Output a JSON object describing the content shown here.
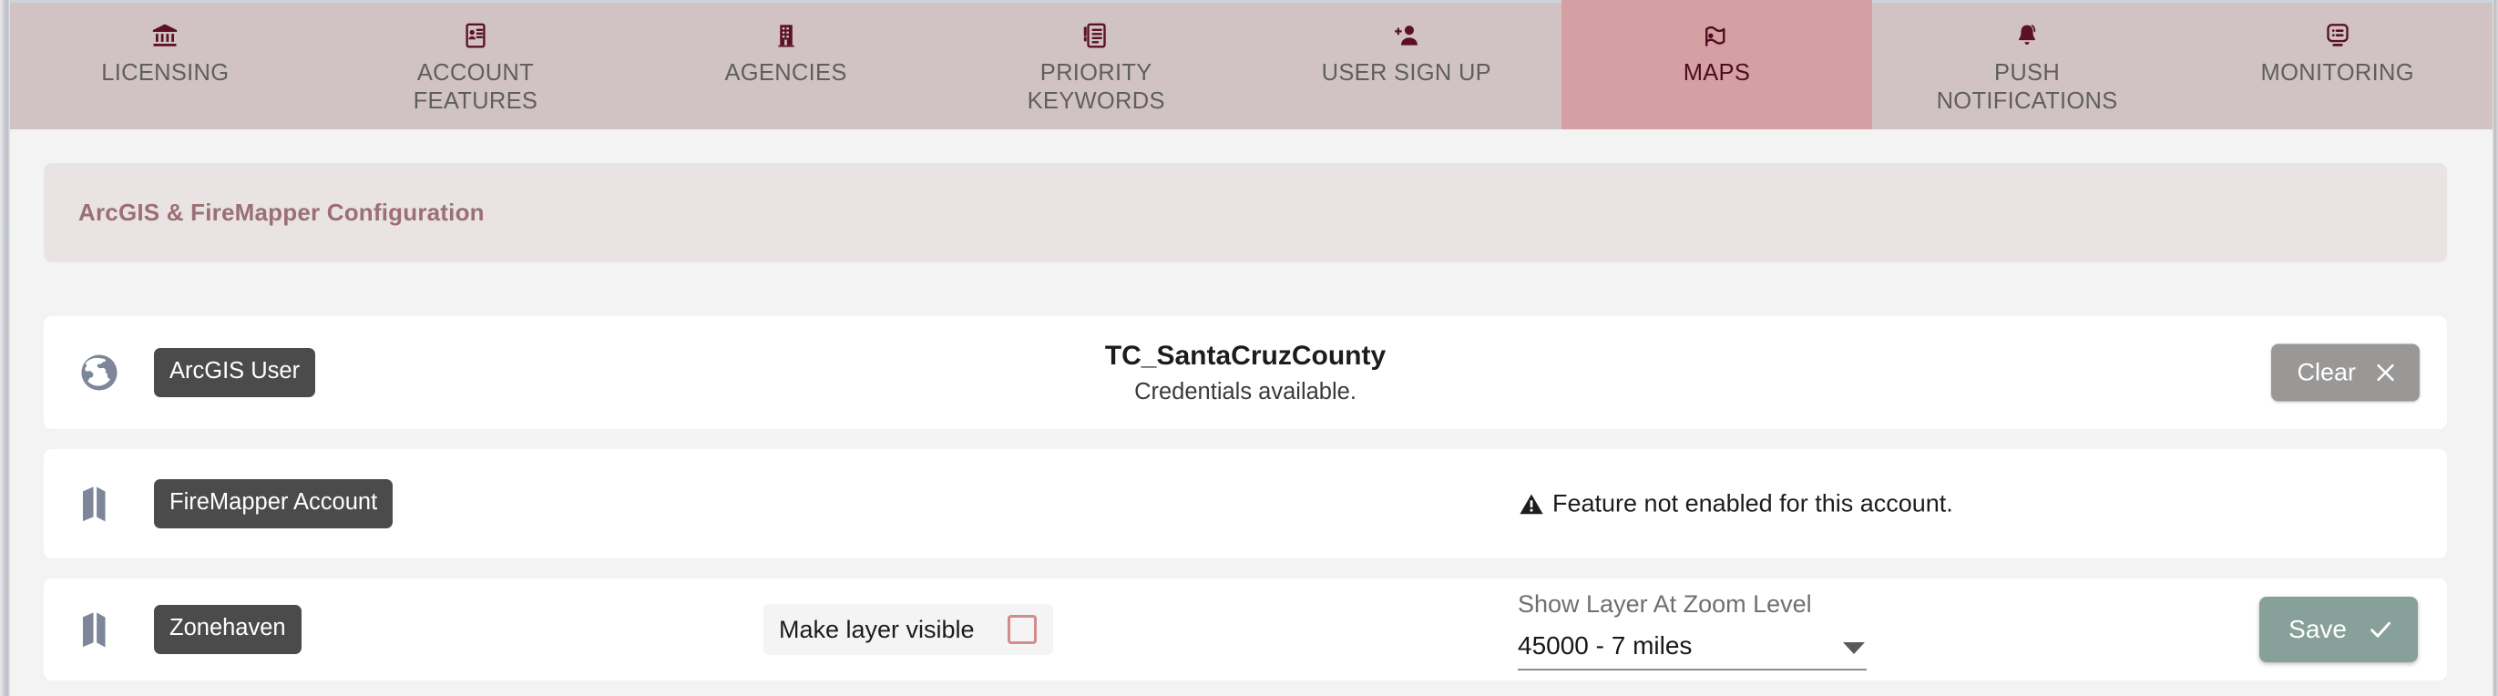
{
  "theme": {
    "tabbar_bg": "#d1c3c3",
    "tab_active_bg": "#d5a0a4",
    "accent_maroon": "#5c1026",
    "section_title_color": "#9b6f74",
    "chip_bg": "#4b4b4b",
    "map_icon_color": "#7e8699",
    "save_button_bg": "#87a099",
    "clear_button_bg": "#9a9797",
    "checkbox_border": "#d38b8b",
    "page_bg": "#f3f3f4"
  },
  "tabs": [
    {
      "label": "LICENSING",
      "icon": "bank-icon",
      "active": false
    },
    {
      "label": "ACCOUNT\nFEATURES",
      "icon": "account-features-icon",
      "active": false
    },
    {
      "label": "AGENCIES",
      "icon": "building-icon",
      "active": false
    },
    {
      "label": "PRIORITY\nKEYWORDS",
      "icon": "priority-keywords-icon",
      "active": false
    },
    {
      "label": "USER SIGN UP",
      "icon": "person-add-icon",
      "active": false
    },
    {
      "label": "MAPS",
      "icon": "map-flag-icon",
      "active": true
    },
    {
      "label": "PUSH\nNOTIFICATIONS",
      "icon": "bell-icon",
      "active": false
    },
    {
      "label": "MONITORING",
      "icon": "monitor-list-icon",
      "active": false
    }
  ],
  "section": {
    "title": "ArcGIS & FireMapper Configuration"
  },
  "rows": {
    "arcgis": {
      "icon": "globe-icon",
      "chip_label": "ArcGIS User",
      "account_name": "TC_SantaCruzCounty",
      "status_text": "Credentials available.",
      "clear_button_label": "Clear",
      "clear_button_icon": "close-icon"
    },
    "firemapper": {
      "icon": "map-icon",
      "chip_label": "FireMapper Account",
      "warning_icon": "warning-triangle-icon",
      "warning_text": "Feature not enabled for this account."
    },
    "zonehaven": {
      "icon": "map-icon",
      "chip_label": "Zonehaven",
      "checkbox_label": "Make layer visible",
      "checkbox_checked": false,
      "select_label": "Show Layer At Zoom Level",
      "select_value": "45000 - 7 miles",
      "select_caret_icon": "chevron-down-icon",
      "save_button_label": "Save",
      "save_button_icon": "check-icon"
    }
  }
}
